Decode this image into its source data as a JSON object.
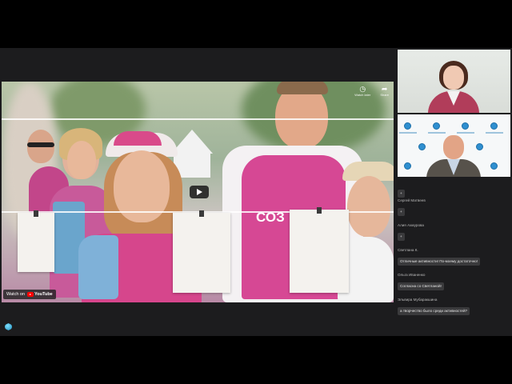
{
  "video": {
    "watch_later_label": "Watch later",
    "share_label": "Share",
    "watch_on_label": "Watch on",
    "youtube_label": "YouTube",
    "shirt_text": "СОЗ"
  },
  "chat": {
    "messages": [
      {
        "sender": "",
        "text": "+"
      },
      {
        "sender": "Сергей Матвеев",
        "text": "+"
      },
      {
        "sender": "Алия Ахмурова",
        "text": "+"
      },
      {
        "sender": "Светлана К.",
        "text": "Отличные активности! По-моему достаточно!"
      },
      {
        "sender": "Ольга Иваненко",
        "text": "Согласна со Светланой!"
      },
      {
        "sender": "Эльвира Мубаракшина",
        "text": "а творчество было среди активностей?"
      }
    ]
  },
  "icons": {
    "play": "play-icon",
    "clock": "clock-icon",
    "share": "share-icon",
    "app": "app-hex-icon"
  },
  "colors": {
    "app_bg": "#1c1c1e",
    "bubble_bg": "#3a3a3c",
    "youtube_red": "#ff0000"
  }
}
